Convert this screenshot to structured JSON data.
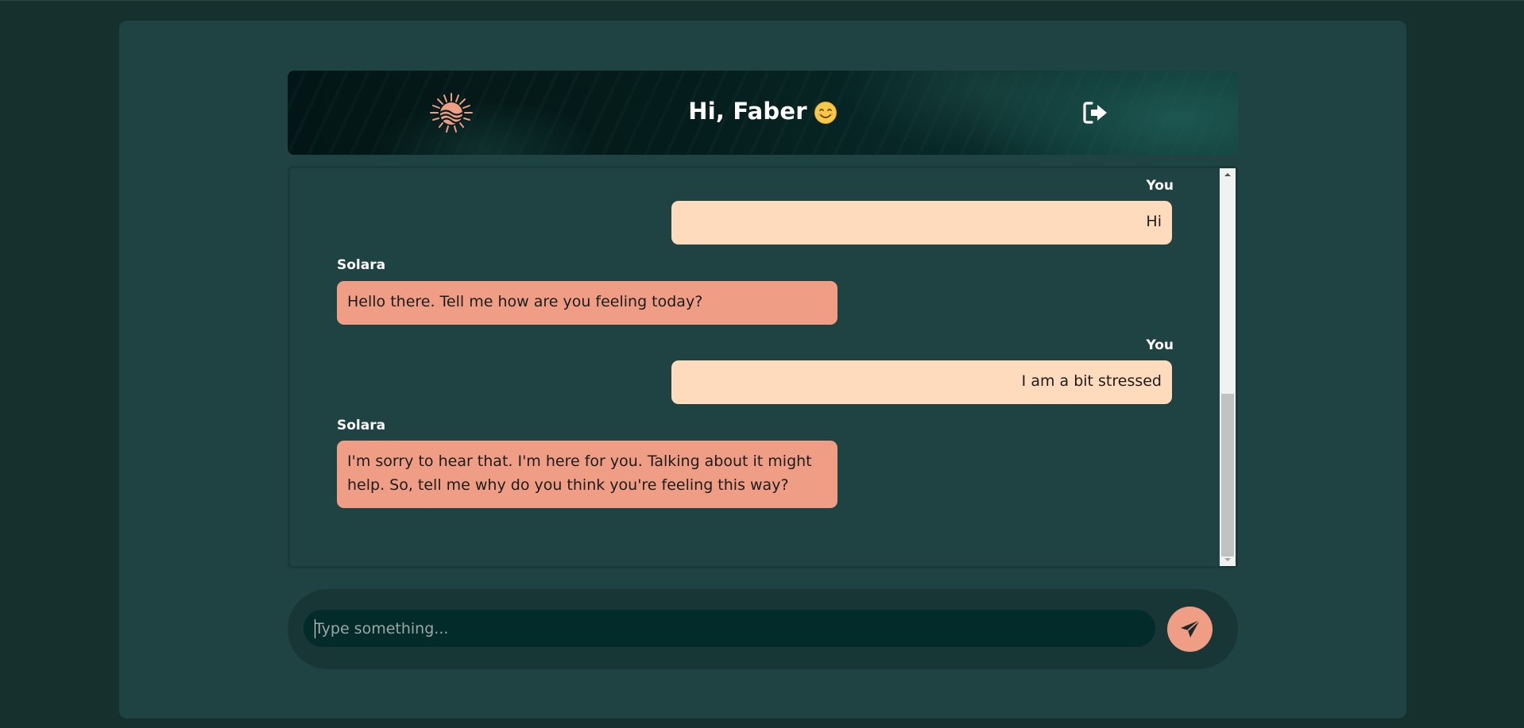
{
  "header": {
    "greeting": "Hi, Faber",
    "logo_icon": "sun-logo-icon",
    "emoji_icon": "smiling-face-icon",
    "logout_icon": "logout-icon"
  },
  "messages": [
    {
      "sender": "You",
      "text": "Hi"
    },
    {
      "sender": "Solara",
      "text": "Hello there. Tell me how are you feeling today?"
    },
    {
      "sender": "You",
      "text": "I am a bit stressed"
    },
    {
      "sender": "Solara",
      "text": "I'm sorry to hear that. I'm here for you. Talking about it might help. So, tell me why do you think you're feeling this way?"
    }
  ],
  "composer": {
    "placeholder": "Type something...",
    "value": "",
    "send_icon": "paper-plane-icon"
  },
  "colors": {
    "page_bg": "#16302e",
    "panel_bg": "#1f4343",
    "user_bubble": "#ffdbbd",
    "bot_bubble": "#ef9e85",
    "accent": "#ef9e85",
    "input_bg": "#032b29"
  }
}
